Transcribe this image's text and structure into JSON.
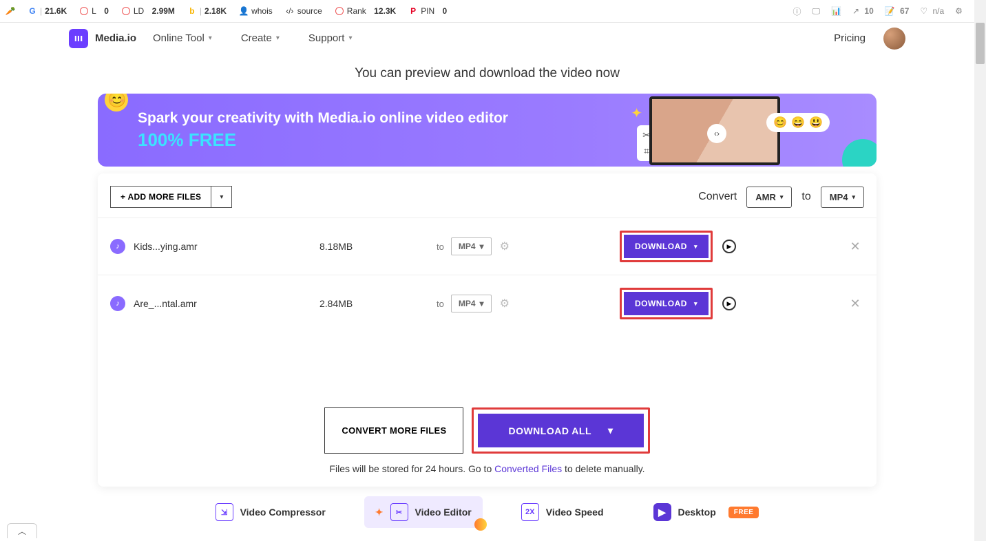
{
  "extbar": {
    "sq_icon": "SQ",
    "g": "21.6K",
    "l_label": "L",
    "l": "0",
    "ld_label": "LD",
    "ld": "2.99M",
    "i": "2.18K",
    "whois": "whois",
    "source": "source",
    "rank_label": "Rank",
    "rank": "12.3K",
    "pin_label": "PIN",
    "pin": "0",
    "right_a": "10",
    "right_b": "67",
    "right_c": "n/a"
  },
  "nav": {
    "brand": "Media.io",
    "items": [
      "Online Tool",
      "Create",
      "Support"
    ],
    "pricing": "Pricing"
  },
  "preview": "You can preview and download the video now",
  "banner": {
    "line1": "Spark your creativity with Media.io online video editor",
    "line2": "100% FREE"
  },
  "card": {
    "add_more": "+ ADD MORE FILES",
    "convert_label": "Convert",
    "from_fmt": "AMR",
    "to_label": "to",
    "to_fmt": "MP4",
    "rows": [
      {
        "name": "Kids...ying.amr",
        "size": "8.18MB",
        "to_lbl": "to",
        "fmt": "MP4",
        "dl": "DOWNLOAD"
      },
      {
        "name": "Are_...ntal.amr",
        "size": "2.84MB",
        "to_lbl": "to",
        "fmt": "MP4",
        "dl": "DOWNLOAD"
      }
    ],
    "convert_more": "CONVERT MORE FILES",
    "download_all": "DOWNLOAD ALL",
    "note_a": "Files will be stored for 24 hours. Go to ",
    "note_link": "Converted Files",
    "note_b": " to delete manually."
  },
  "dock": {
    "compressor": "Video Compressor",
    "editor": "Video Editor",
    "speed": "Video Speed",
    "speed_badge": "2X",
    "desktop": "Desktop",
    "free": "FREE"
  }
}
